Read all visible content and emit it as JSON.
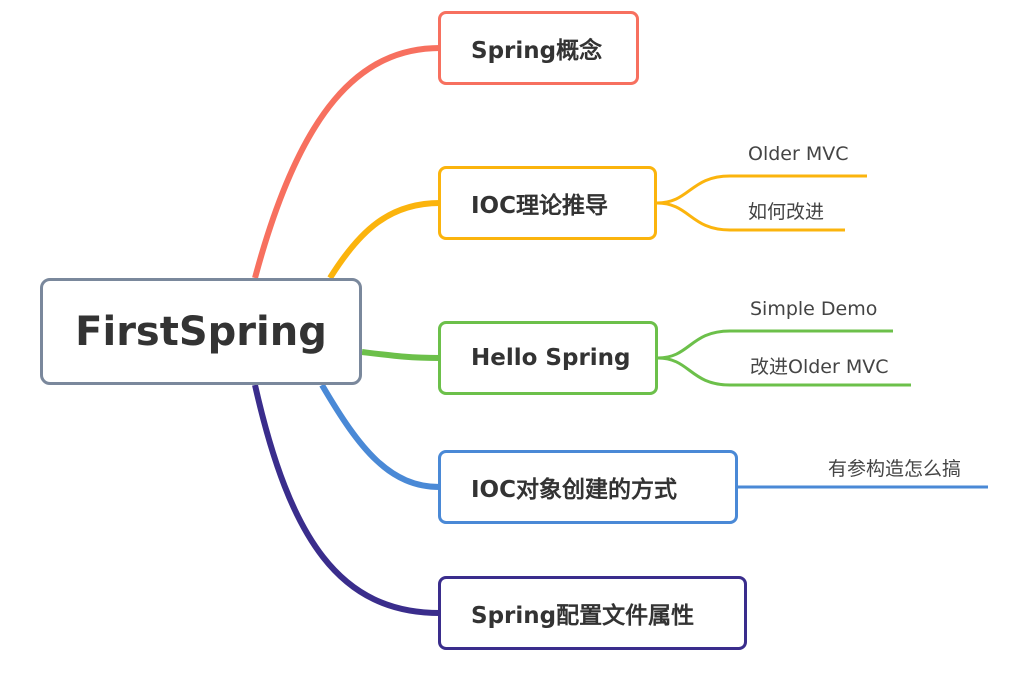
{
  "root": {
    "label": "FirstSpring",
    "color": "#7a889c"
  },
  "branches": [
    {
      "label": "Spring概念",
      "color": "#f7705f",
      "children": []
    },
    {
      "label": "IOC理论推导",
      "color": "#fbb40d",
      "children": [
        "Older MVC",
        "如何改进"
      ]
    },
    {
      "label": "Hello Spring",
      "color": "#6cc04a",
      "children": [
        "Simple Demo",
        "改进Older MVC"
      ]
    },
    {
      "label": "IOC对象创建的方式",
      "color": "#4a89d6",
      "children": [
        "有参构造怎么搞"
      ]
    },
    {
      "label": "Spring配置文件属性",
      "color": "#3a2d8c",
      "children": []
    }
  ]
}
